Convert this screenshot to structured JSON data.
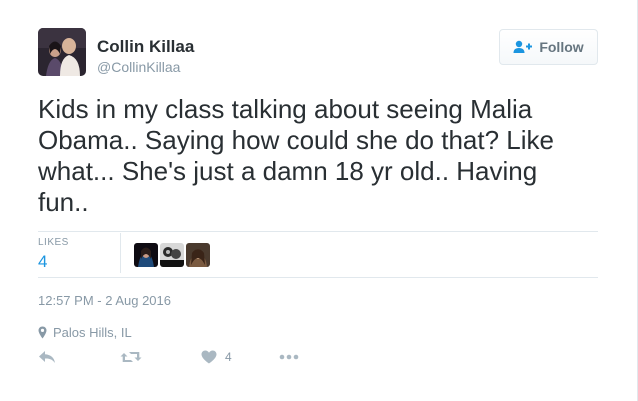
{
  "user": {
    "name": "Collin Killaa",
    "handle": "@CollinKillaa",
    "avatar_icon": "profile-photo"
  },
  "follow_button": {
    "label": "Follow",
    "icon": "add-user-icon"
  },
  "tweet": {
    "text": "Kids in my class talking about seeing Malia Obama.. Saying how could she do that? Like what... She's just a damn 18 yr old.. Having fun..",
    "likes_label": "LIKES",
    "likes_count": "4",
    "timestamp": "12:57 PM - 2 Aug 2016",
    "location": "Palos Hills, IL"
  },
  "actions": {
    "reply_icon": "reply-icon",
    "retweet_icon": "retweet-icon",
    "like_icon": "heart-icon",
    "like_count": "4",
    "more_icon": "more-icon"
  },
  "colors": {
    "accent": "#1b95e0",
    "muted": "#8899a6",
    "text": "#292f33",
    "border": "#e1e8ed"
  }
}
